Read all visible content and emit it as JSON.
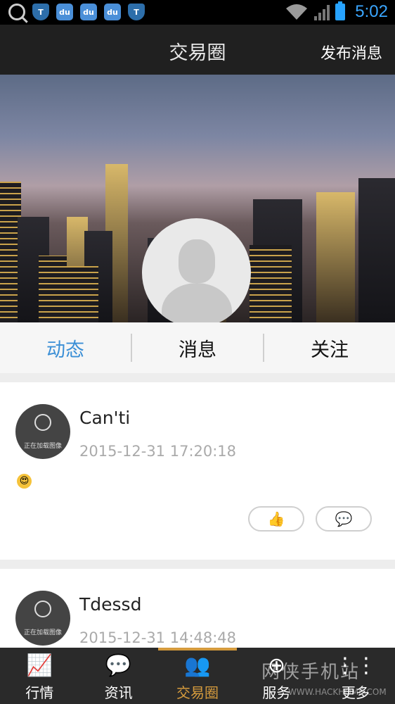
{
  "status_bar": {
    "time": "5:02",
    "notification_icons": [
      "search-icon",
      "shield-icon",
      "baidu-paw-icon",
      "baidu-paw-icon",
      "baidu-paw-icon",
      "shield-icon"
    ],
    "baidu_text": "du",
    "clock_color": "#3aa6ff"
  },
  "header": {
    "title": "交易圈",
    "action_label": "发布消息"
  },
  "tabs": [
    {
      "label": "动态",
      "active": true
    },
    {
      "label": "消息",
      "active": false
    },
    {
      "label": "关注",
      "active": false
    }
  ],
  "posts": [
    {
      "author": "Can'ti",
      "time": "2015-12-31 17:20:18",
      "avatar_caption": "正在加载图像",
      "content_emoji": "😍",
      "like_icon": "👍",
      "comment_icon": "💬"
    },
    {
      "author": "Tdessd",
      "time": "2015-12-31 14:48:48",
      "avatar_caption": "正在加载图像"
    }
  ],
  "bottom_nav": [
    {
      "label": "行情",
      "icon": "📈",
      "icon_name": "chart-icon",
      "active": false
    },
    {
      "label": "资讯",
      "icon": "💬",
      "icon_name": "news-icon",
      "active": false
    },
    {
      "label": "交易圈",
      "icon": "👥",
      "icon_name": "people-icon",
      "active": true
    },
    {
      "label": "服务",
      "icon": "⊕",
      "icon_name": "service-icon",
      "active": false
    },
    {
      "label": "更多",
      "icon": "⋮⋮",
      "icon_name": "more-icon",
      "active": false
    }
  ],
  "watermark": {
    "text": "网侠手机站",
    "url": "WWW.HACKHOME.COM"
  },
  "colors": {
    "accent": "#3b8fd6",
    "nav_active": "#d59b3d",
    "header_bg": "#202020"
  }
}
